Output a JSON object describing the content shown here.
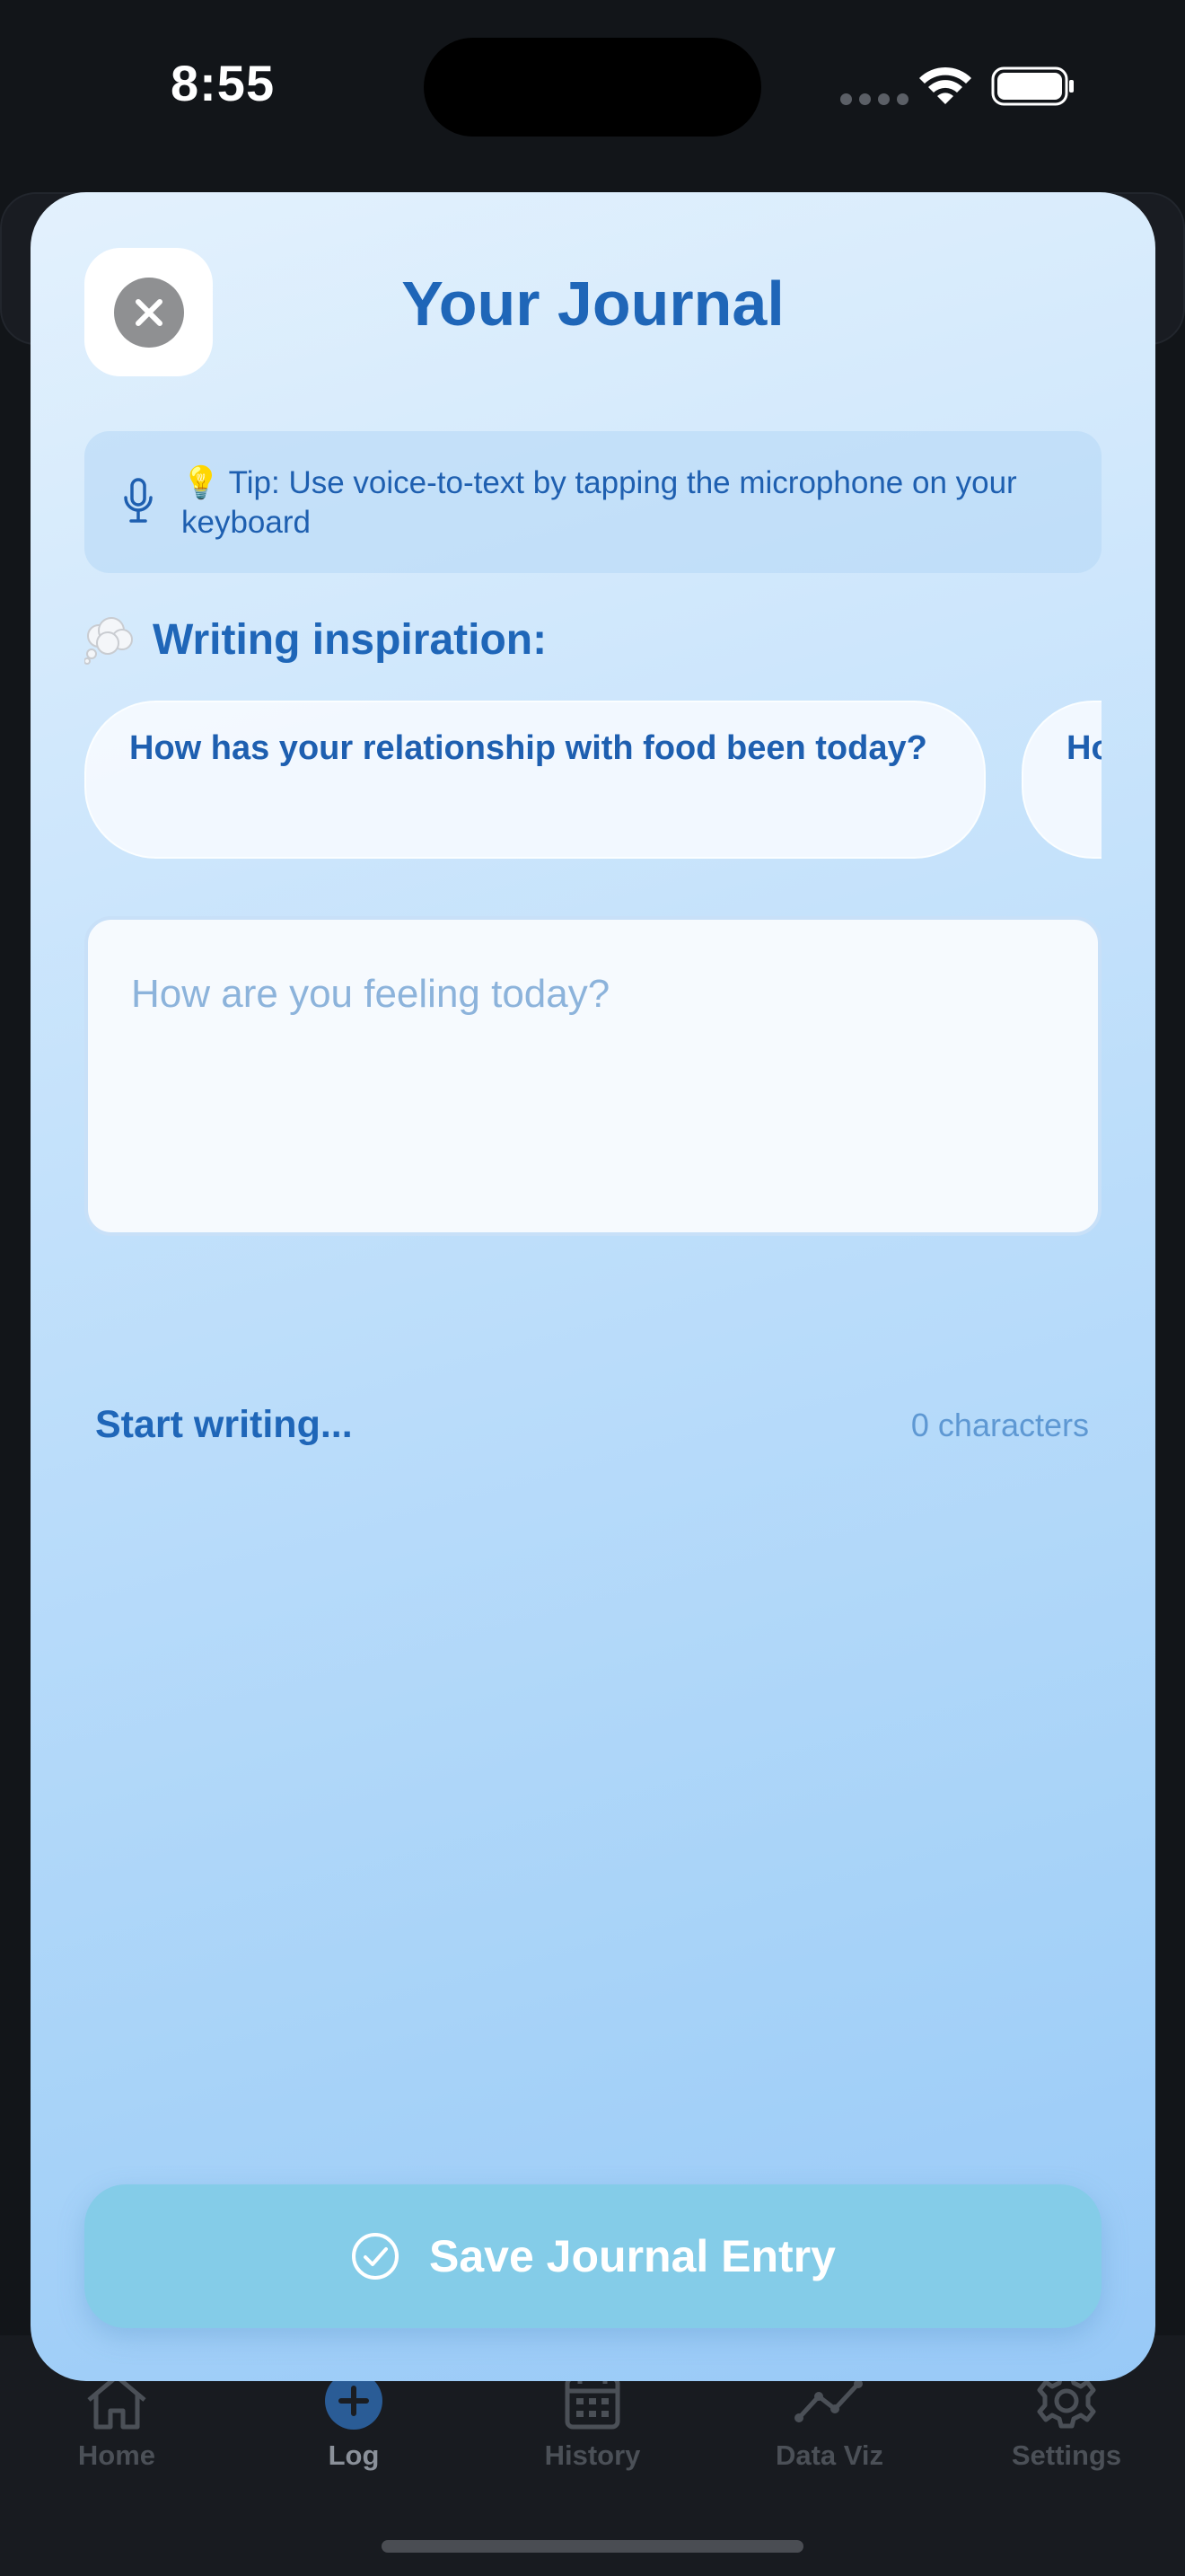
{
  "status_bar": {
    "time": "8:55"
  },
  "modal": {
    "title": "Your Journal",
    "tip": "💡 Tip: Use voice-to-text by tapping the microphone on your keyboard",
    "inspiration_label": "Writing inspiration:",
    "prompts": [
      "How has your relationship with food been today?",
      "Ho"
    ],
    "journal_placeholder": "How are you feeling today?",
    "journal_value": "",
    "start_writing": "Start writing...",
    "char_count": "0 characters",
    "save_label": "Save Journal Entry"
  },
  "tabs": [
    {
      "label": "Home",
      "icon": "house-icon"
    },
    {
      "label": "Log",
      "icon": "plus-circle-icon"
    },
    {
      "label": "History",
      "icon": "calendar-icon"
    },
    {
      "label": "Data Viz",
      "icon": "chart-line-icon"
    },
    {
      "label": "Settings",
      "icon": "gear-icon"
    }
  ],
  "colors": {
    "accent": "#1f66b8",
    "save_button": "#84cce8",
    "modal_top": "#e3f1fd",
    "modal_bottom": "#98c9f7"
  }
}
